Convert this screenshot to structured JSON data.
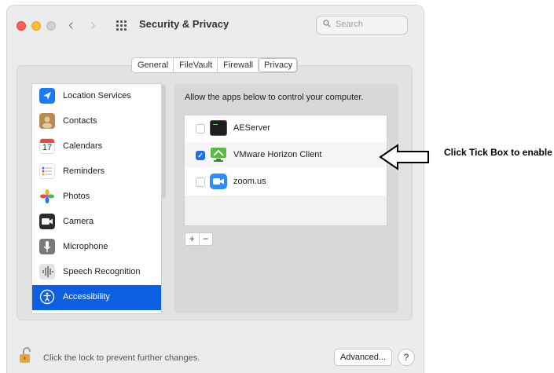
{
  "window": {
    "title": "Security & Privacy",
    "search_placeholder": "Search"
  },
  "tabs": [
    {
      "label": "General",
      "active": false
    },
    {
      "label": "FileVault",
      "active": false
    },
    {
      "label": "Firewall",
      "active": false
    },
    {
      "label": "Privacy",
      "active": true
    }
  ],
  "sidebar": {
    "items": [
      {
        "label": "Location Services",
        "icon": "location-arrow-icon",
        "selected": false
      },
      {
        "label": "Contacts",
        "icon": "contacts-icon",
        "selected": false
      },
      {
        "label": "Calendars",
        "icon": "calendar-icon",
        "selected": false,
        "icon_text": "17"
      },
      {
        "label": "Reminders",
        "icon": "reminders-icon",
        "selected": false
      },
      {
        "label": "Photos",
        "icon": "photos-icon",
        "selected": false
      },
      {
        "label": "Camera",
        "icon": "camera-icon",
        "selected": false
      },
      {
        "label": "Microphone",
        "icon": "microphone-icon",
        "selected": false
      },
      {
        "label": "Speech Recognition",
        "icon": "speech-recognition-icon",
        "selected": false
      },
      {
        "label": "Accessibility",
        "icon": "accessibility-icon",
        "selected": true
      }
    ]
  },
  "main": {
    "instruction": "Allow the apps below to control your computer.",
    "apps": [
      {
        "label": "AEServer",
        "checked": false,
        "icon": "terminal-icon"
      },
      {
        "label": "VMware Horizon Client",
        "checked": true,
        "icon": "vmware-horizon-icon"
      },
      {
        "label": "zoom.us",
        "checked": false,
        "icon": "zoom-icon"
      }
    ],
    "add_label": "+",
    "remove_label": "−"
  },
  "footer": {
    "lock_text": "Click the lock to prevent further changes.",
    "advanced_label": "Advanced...",
    "help_label": "?"
  },
  "annotation": {
    "text": "Click Tick Box to enable"
  },
  "colors": {
    "accent": "#0b5fe0",
    "checkbox_on": "#1e6fe8"
  }
}
